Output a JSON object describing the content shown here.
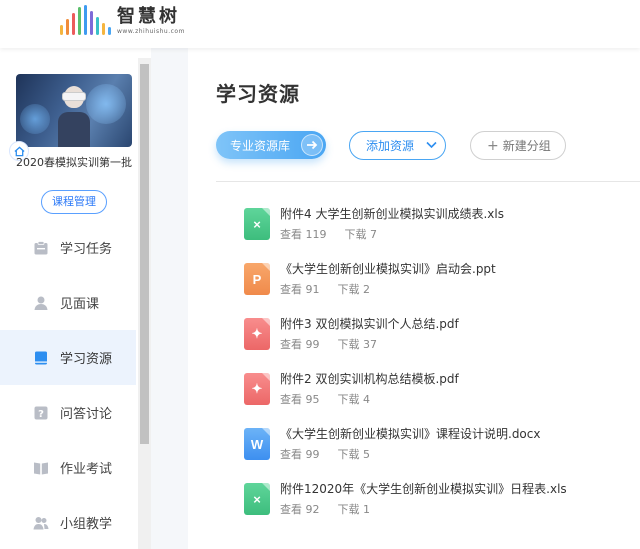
{
  "header": {
    "logo_text": "智慧树",
    "logo_url": "www.zhihuishu.com",
    "logo_bar_colors": [
      "#f5b53f",
      "#f08c3a",
      "#ec5b5b",
      "#5bbf6b",
      "#3e9bf0",
      "#7d6bd8",
      "#39c0c8",
      "#f5b53f",
      "#4aa6f3"
    ]
  },
  "sidebar": {
    "course_title": "2020春模拟实训第一批",
    "course_manage": "课程管理",
    "items": [
      {
        "label": "学习任务",
        "icon": "task-icon",
        "active": false
      },
      {
        "label": "见面课",
        "icon": "person-icon",
        "active": false
      },
      {
        "label": "学习资源",
        "icon": "book-icon",
        "active": true
      },
      {
        "label": "问答讨论",
        "icon": "question-icon",
        "active": false
      },
      {
        "label": "作业考试",
        "icon": "open-book-icon",
        "active": false
      },
      {
        "label": "小组教学",
        "icon": "group-icon",
        "active": false
      }
    ]
  },
  "main": {
    "title": "学习资源",
    "btn_library": "专业资源库",
    "btn_add": "添加资源",
    "btn_new_group": "新建分组",
    "btn_new_group_plus": "+",
    "view_prefix": "查看",
    "download_prefix": "下载",
    "files": [
      {
        "name": "附件4 大学生创新创业模拟实训成绩表.xls",
        "type": "xls",
        "glyph": "×",
        "views": "119",
        "downloads": "7"
      },
      {
        "name": "《大学生创新创业模拟实训》启动会.ppt",
        "type": "ppt",
        "glyph": "P",
        "views": "91",
        "downloads": "2"
      },
      {
        "name": "附件3 双创模拟实训个人总结.pdf",
        "type": "pdf",
        "glyph": "✦",
        "views": "99",
        "downloads": "37"
      },
      {
        "name": "附件2 双创实训机构总结模板.pdf",
        "type": "pdf",
        "glyph": "✦",
        "views": "95",
        "downloads": "4"
      },
      {
        "name": "《大学生创新创业模拟实训》课程设计说明.docx",
        "type": "docx",
        "glyph": "W",
        "views": "99",
        "downloads": "5"
      },
      {
        "name": "附件12020年《大学生创新创业模拟实训》日程表.xls",
        "type": "xls",
        "glyph": "×",
        "views": "92",
        "downloads": "1"
      }
    ]
  }
}
